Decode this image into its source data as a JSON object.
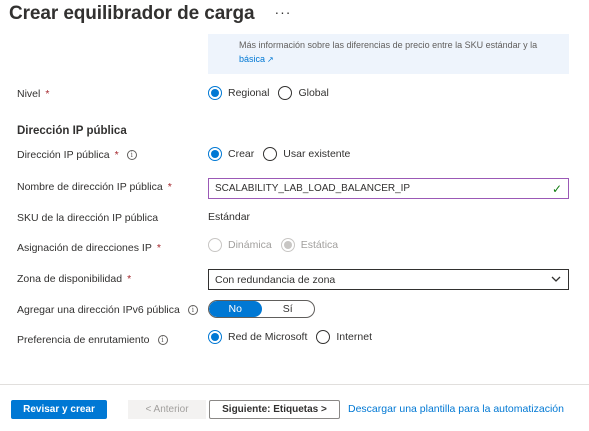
{
  "header": {
    "title": "Crear equilibrador de carga",
    "more": "···"
  },
  "info": {
    "line1": "Más información sobre las diferencias de precio entre la SKU estándar y la",
    "line2": "básica"
  },
  "tier": {
    "label": "Nivel",
    "options": [
      "Regional",
      "Global"
    ],
    "selected": "Regional"
  },
  "public_ip": {
    "section_title": "Dirección IP pública",
    "address_label": "Dirección IP pública",
    "address_options": [
      "Crear",
      "Usar existente"
    ],
    "address_selected": "Crear",
    "name_label": "Nombre de dirección IP pública",
    "name_value": "SCALABILITY_LAB_LOAD_BALANCER_IP",
    "sku_label": "SKU de la dirección IP pública",
    "sku_value": "Estándar",
    "assignment_label": "Asignación de direcciones IP",
    "assignment_options": [
      "Dinámica",
      "Estática"
    ],
    "assignment_selected": "Estática",
    "zone_label": "Zona de disponibilidad",
    "zone_value": "Con redundancia de zona",
    "ipv6_label": "Agregar una dirección IPv6 pública",
    "ipv6_options": [
      "No",
      "Sí"
    ],
    "ipv6_selected": "No",
    "routing_label": "Preferencia de enrutamiento",
    "routing_options": [
      "Red de Microsoft",
      "Internet"
    ],
    "routing_selected": "Red de Microsoft"
  },
  "footer": {
    "review_create": "Revisar y crear",
    "previous": "< Anterior",
    "next": "Siguiente: Etiquetas >",
    "download_template": "Descargar una plantilla para la automatización"
  },
  "colors": {
    "accent": "#0078d4",
    "required": "#a4262c",
    "valid": "#107c10"
  }
}
